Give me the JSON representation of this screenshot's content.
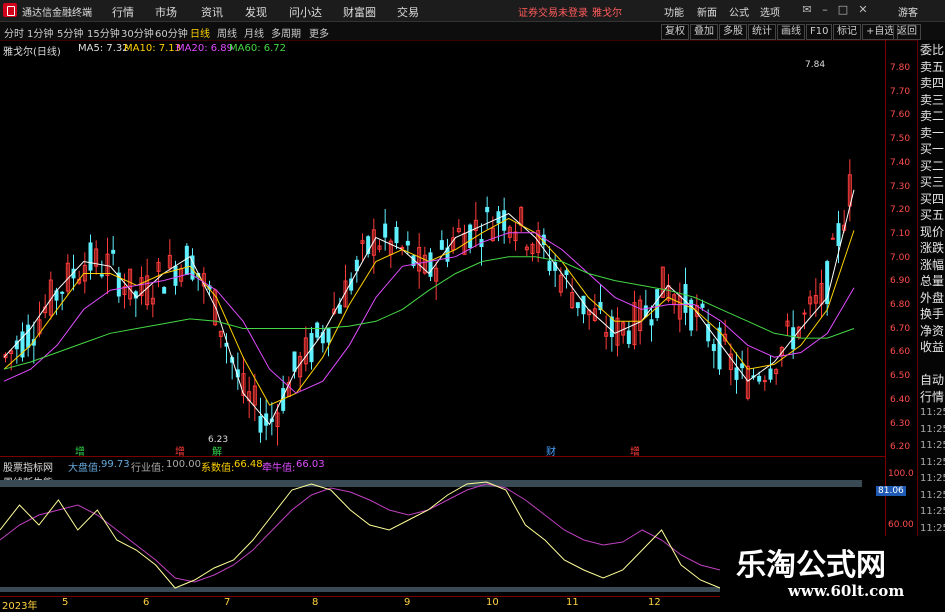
{
  "app": {
    "title": "通达信金融终端"
  },
  "menu": [
    "行情",
    "市场",
    "资讯",
    "发现",
    "问小达",
    "财富圈",
    "交易"
  ],
  "alert": "证券交易未登录",
  "stock_link": "雅戈尔",
  "top_right": [
    "功能",
    "新面",
    "公式",
    "选项",
    "游客"
  ],
  "toolbar": {
    "periods": [
      "分时",
      "1分钟",
      "5分钟",
      "15分钟",
      "30分钟",
      "60分钟",
      "日线",
      "周线",
      "月线",
      "多周期",
      "更多"
    ],
    "selected": "日线",
    "right": [
      "复权",
      "叠加",
      "多股",
      "统计",
      "画线",
      "F10",
      "标记",
      "+自选",
      "返回"
    ]
  },
  "kline_header": {
    "name": "雅戈尔(日线)",
    "ma5": "MA5: 7.32",
    "ma10": "MA10: 7.13",
    "ma20": "MA20: 6.89",
    "ma60": "MA60: 6.72"
  },
  "price_axis": [
    "7.80",
    "7.70",
    "7.60",
    "7.50",
    "7.40",
    "7.30",
    "7.20",
    "7.10",
    "7.00",
    "6.90",
    "6.80",
    "6.70",
    "6.60",
    "6.50",
    "6.40",
    "6.30",
    "6.20"
  ],
  "peak_label": "7.84",
  "low_label": "6.23",
  "events": [
    {
      "t": "增",
      "c": "#2fd24a"
    },
    {
      "t": "增",
      "c": "#ff3b3b"
    },
    {
      "t": "解",
      "c": "#2fd24a"
    },
    {
      "t": "财",
      "c": "#4aa3ff"
    },
    {
      "t": "增",
      "c": "#ff3b3b"
    }
  ],
  "indicator_header": {
    "name": "股票指标网",
    "label1": "大盘值:",
    "val1": "99.73",
    "label2": "行业值:",
    "val2": "100.00",
    "label3": "系数值:",
    "val3": "66.48",
    "label4": "牵牛值:",
    "val4": "66.03"
  },
  "indicator_title": "周线断牛熊",
  "ind_axis": [
    "100.0",
    "81.06",
    "60.00"
  ],
  "dates": [
    "2023年",
    "5",
    "6",
    "7",
    "8",
    "9",
    "10",
    "11",
    "12"
  ],
  "side_panel": [
    "委比",
    "卖五",
    "卖四",
    "卖三",
    "卖二",
    "卖一",
    "买一",
    "买二",
    "买三",
    "买四",
    "买五",
    "现价",
    "涨跌",
    "涨幅",
    "总量",
    "外盘",
    "换手",
    "净资",
    "收益",
    "",
    "自动",
    "行情",
    "11:25",
    "11:25",
    "11:25",
    "11:25",
    "11:25",
    "11:25",
    "11:25",
    "11:25"
  ],
  "watermark": {
    "title": "乐淘公式网",
    "url": "www.60lt.com"
  },
  "chart_data": {
    "type": "line",
    "series": [
      {
        "name": "MA5",
        "values": [
          6.6,
          6.72,
          6.88,
          7.0,
          6.98,
          6.85,
          6.95,
          7.02,
          6.8,
          6.45,
          6.32,
          6.55,
          6.7,
          6.9,
          7.1,
          7.05,
          6.95,
          7.1,
          7.15,
          7.2,
          7.1,
          6.95,
          6.8,
          6.7,
          6.75,
          6.9,
          6.8,
          6.65,
          6.5,
          6.58,
          6.72,
          6.85,
          7.3
        ]
      },
      {
        "name": "MA10",
        "values": [
          6.55,
          6.65,
          6.8,
          6.95,
          6.95,
          6.9,
          6.95,
          6.98,
          6.85,
          6.6,
          6.4,
          6.45,
          6.6,
          6.82,
          7.0,
          7.05,
          7.0,
          7.05,
          7.12,
          7.18,
          7.12,
          7.0,
          6.85,
          6.75,
          6.75,
          6.85,
          6.8,
          6.7,
          6.55,
          6.57,
          6.65,
          6.8,
          7.13
        ]
      },
      {
        "name": "MA20",
        "values": [
          6.5,
          6.55,
          6.65,
          6.8,
          6.88,
          6.9,
          6.92,
          6.95,
          6.88,
          6.75,
          6.55,
          6.45,
          6.5,
          6.65,
          6.85,
          6.98,
          7.0,
          7.02,
          7.08,
          7.12,
          7.12,
          7.05,
          6.95,
          6.85,
          6.8,
          6.82,
          6.82,
          6.75,
          6.65,
          6.6,
          6.62,
          6.7,
          6.89
        ]
      },
      {
        "name": "MA60",
        "values": [
          6.55,
          6.58,
          6.62,
          6.66,
          6.7,
          6.72,
          6.74,
          6.76,
          6.75,
          6.72,
          6.72,
          6.72,
          6.72,
          6.73,
          6.75,
          6.8,
          6.88,
          6.95,
          7.0,
          7.02,
          7.02,
          7.0,
          6.95,
          6.92,
          6.9,
          6.88,
          6.85,
          6.8,
          6.75,
          6.7,
          6.68,
          6.68,
          6.72
        ]
      }
    ],
    "ylim": [
      6.2,
      7.85
    ]
  }
}
